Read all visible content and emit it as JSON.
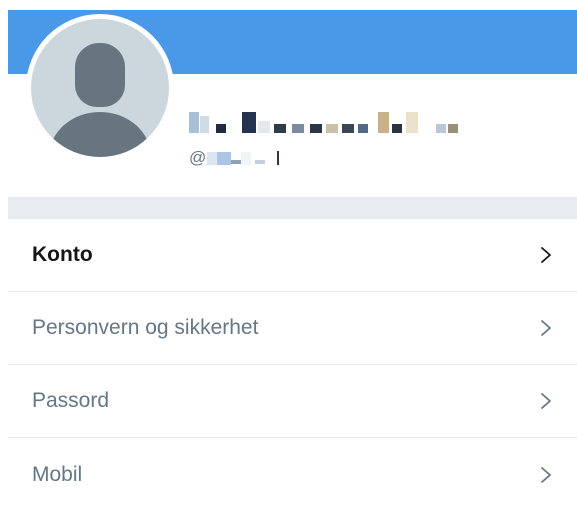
{
  "profile": {
    "banner_color": "#4a99e9",
    "avatar_color": "#ccd6dd",
    "display_name_obscured": true,
    "handle_prefix": "@",
    "handle_obscured": true
  },
  "menu": {
    "items": [
      {
        "label": "Konto",
        "active": true
      },
      {
        "label": "Personvern og sikkerhet",
        "active": false
      },
      {
        "label": "Passord",
        "active": false
      },
      {
        "label": "Mobil",
        "active": false
      }
    ],
    "chevron_icon": "chevron-right-icon"
  },
  "colors": {
    "divider": "#e6ecf0",
    "text_active": "#14171a",
    "text_secondary": "#657786"
  }
}
